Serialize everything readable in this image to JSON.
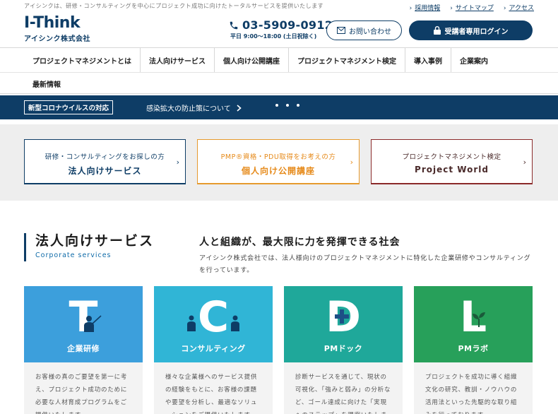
{
  "header": {
    "tagline": "アイシンクは、研修・コンサルティングを中心にプロジェクト成功に向けたトータルサービスを提供いたします",
    "util_links": [
      "採用情報",
      "サイトマップ",
      "アクセス"
    ],
    "logo_main": "I-Think",
    "logo_sub": "アイシンク株式会社",
    "phone": "03-5909-0912",
    "hours": "平日 9:00〜18:00 (土日祝除く)",
    "contact_label": "お問い合わせ",
    "login_label": "受講者専用ログイン"
  },
  "nav": {
    "row1": [
      "プロジェクトマネジメントとは",
      "法人向けサービス",
      "個人向け公開講座",
      "プロジェクトマネジメント検定",
      "導入事例",
      "企業案内"
    ],
    "row2": [
      "最新情報"
    ]
  },
  "news": {
    "tag": "新型コロナウイルスの対応",
    "text": "感染拡大の防止策について"
  },
  "cards": [
    {
      "small": "研修・コンサルティングをお探しの方",
      "big": "法人向けサービス"
    },
    {
      "small": "PMP®資格・PDU取得をお考えの方",
      "big": "個人向け公開講座"
    },
    {
      "small": "プロジェクトマネジメント検定",
      "big": "Project World"
    }
  ],
  "corporate": {
    "title": "法人向けサービス",
    "subtitle": "Corporate services",
    "lead_title": "人と組織が、最大限に力を発揮できる社会",
    "lead_text": "アイシンク株式会社では、法人様向けのプロジェクトマネジメントに特化した企業研修やコンサルティングを行っています。"
  },
  "services": [
    {
      "letter": "T",
      "name": "企業研修",
      "desc": "お客様の真のご要望を第一に考え、プロジェクト成功のために必要な人材育成プログラムをご提供いたします。"
    },
    {
      "letter": "C",
      "name": "コンサルティング",
      "desc": "様々な企業様へのサービス提供の経験をもとに、お客様の課題や要望を分析し、最適なソリューションをご提供いたします。"
    },
    {
      "letter": "D",
      "name": "PMドック",
      "desc": "診断サービスを通じて、現状の可視化、「強みと弱み」の分析など、ゴール達成に向けた「実現へのステップ」を提案いたします。"
    },
    {
      "letter": "L",
      "name": "PMラボ",
      "desc": "プロジェクトを成功に導く組織文化の研究、教訓・ノウハウの活用法といった先駆的な取り組みを行っております。"
    }
  ],
  "colors": {
    "navy": "#0e3d66",
    "orange": "#e69a2e",
    "maroon": "#8b2a2a",
    "svc_blue": "#3c9fdc",
    "svc_cyan": "#30b5d6",
    "svc_teal": "#1fa89a",
    "svc_green": "#27a05a"
  }
}
